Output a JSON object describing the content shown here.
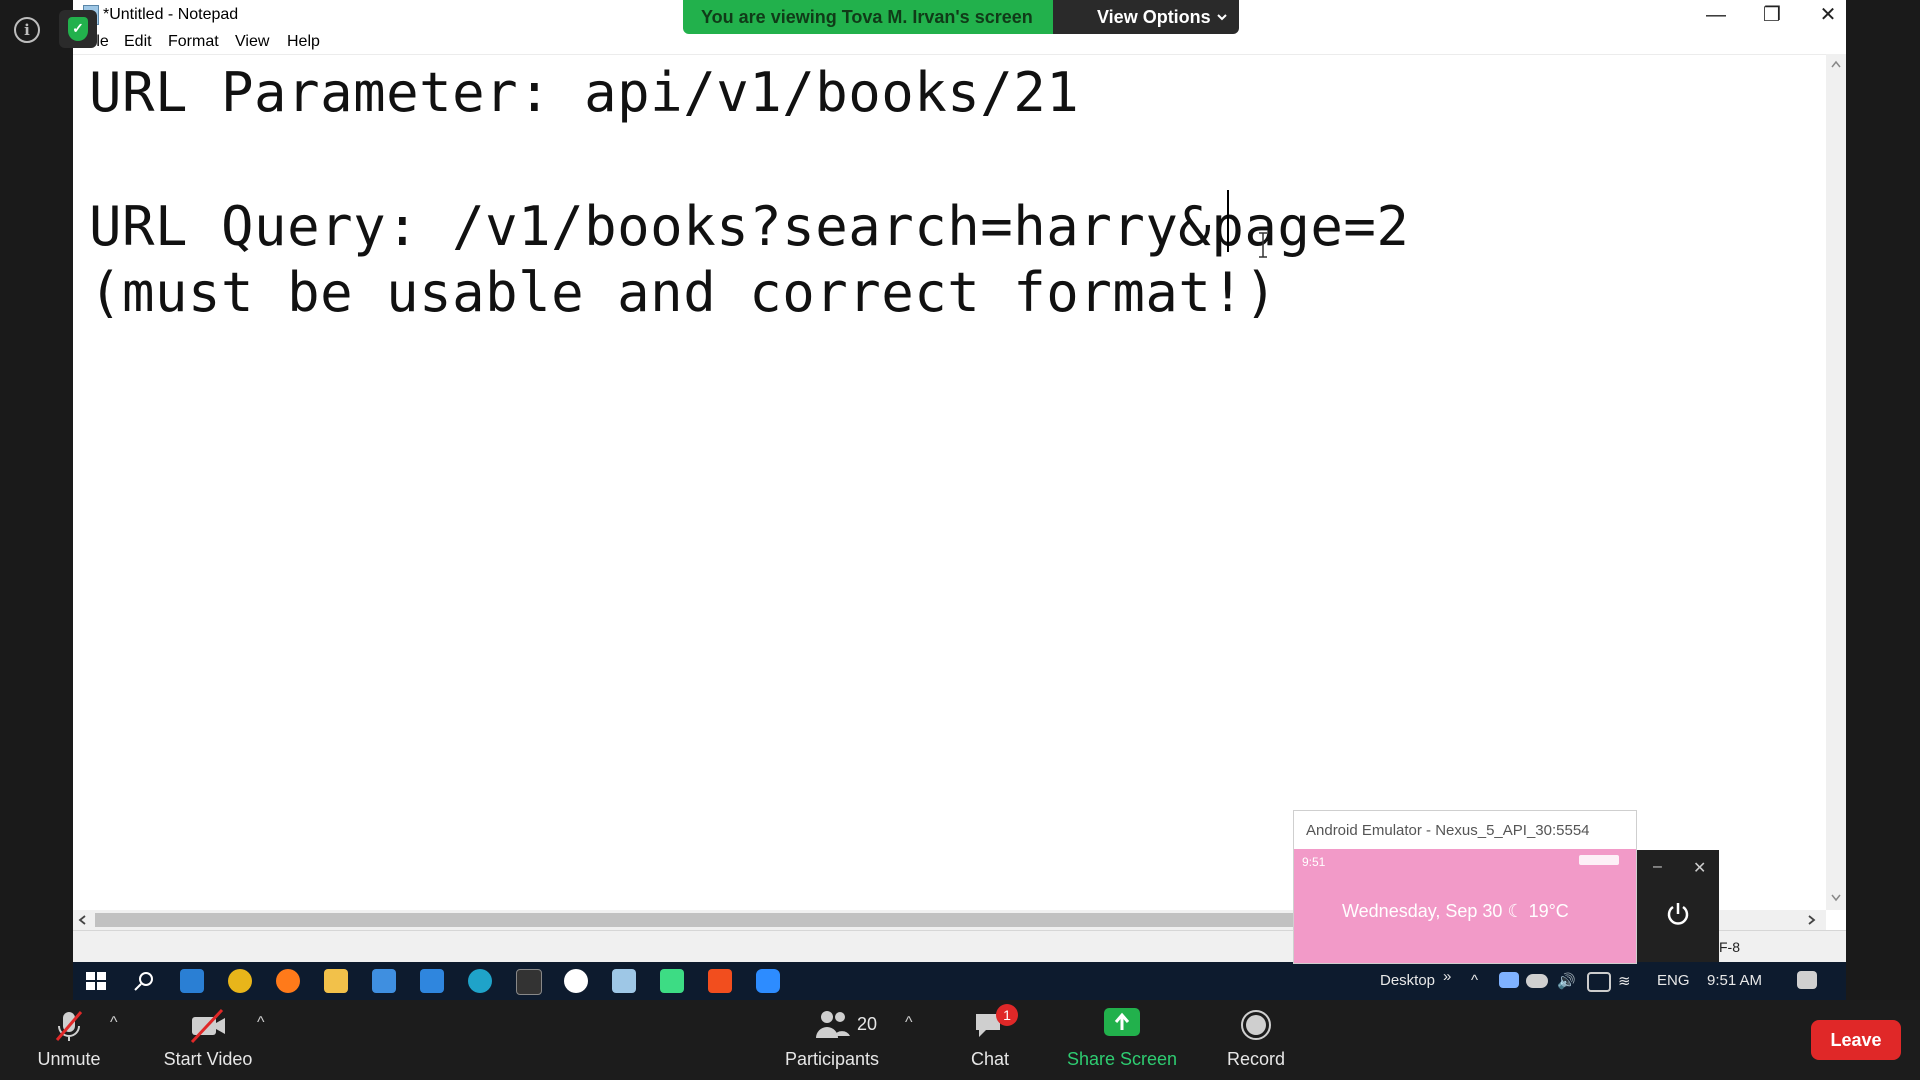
{
  "meeting": {
    "banner_text": "You are viewing Tova M. Irvan's screen",
    "view_options_label": "View Options",
    "info_icon": "i"
  },
  "notepad": {
    "title": "*Untitled - Notepad",
    "menu": [
      "File",
      "Edit",
      "Format",
      "View",
      "Help"
    ],
    "lines": [
      "URL Parameter: api/v1/books/21",
      "URL Query: /v1/books?search=harry&page=2",
      "(must be usable and correct format!)"
    ],
    "status_encoding": "F-8"
  },
  "emulator": {
    "title": "Android Emulator - Nexus_5_API_30:5554",
    "time": "9:51",
    "date_weather": "Wednesday, Sep 30  ☾ 19°C"
  },
  "taskbar": {
    "desktop_label": "Desktop",
    "language": "ENG",
    "clock": "9:51 AM"
  },
  "zoom_controls": {
    "unmute": "Unmute",
    "start_video": "Start Video",
    "participants": "Participants",
    "participants_count": "20",
    "chat": "Chat",
    "chat_badge": "1",
    "share_screen": "Share Screen",
    "record": "Record",
    "leave": "Leave"
  },
  "colors": {
    "share_green": "#22b14c",
    "leave_red": "#e02828",
    "taskbar": "#0d1b2e"
  }
}
